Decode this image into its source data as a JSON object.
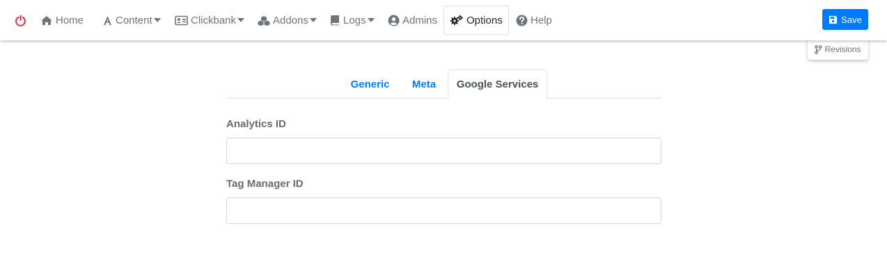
{
  "nav": {
    "power_icon": "power-off-icon",
    "home": "Home",
    "content": "Content",
    "clickbank": "Clickbank",
    "addons": "Addons",
    "logs": "Logs",
    "admins": "Admins",
    "options": "Options",
    "help": "Help"
  },
  "toolbar": {
    "save_label": "Save",
    "revisions_label": "Revisions"
  },
  "tabs": [
    "Generic",
    "Meta",
    "Google Services"
  ],
  "form": {
    "analytics_label": "Analytics ID",
    "analytics_value": "",
    "tagmanager_label": "Tag Manager ID",
    "tagmanager_value": ""
  },
  "colors": {
    "accent": "#007bff",
    "power": "#dc3545",
    "nav_text": "#6c757d"
  }
}
